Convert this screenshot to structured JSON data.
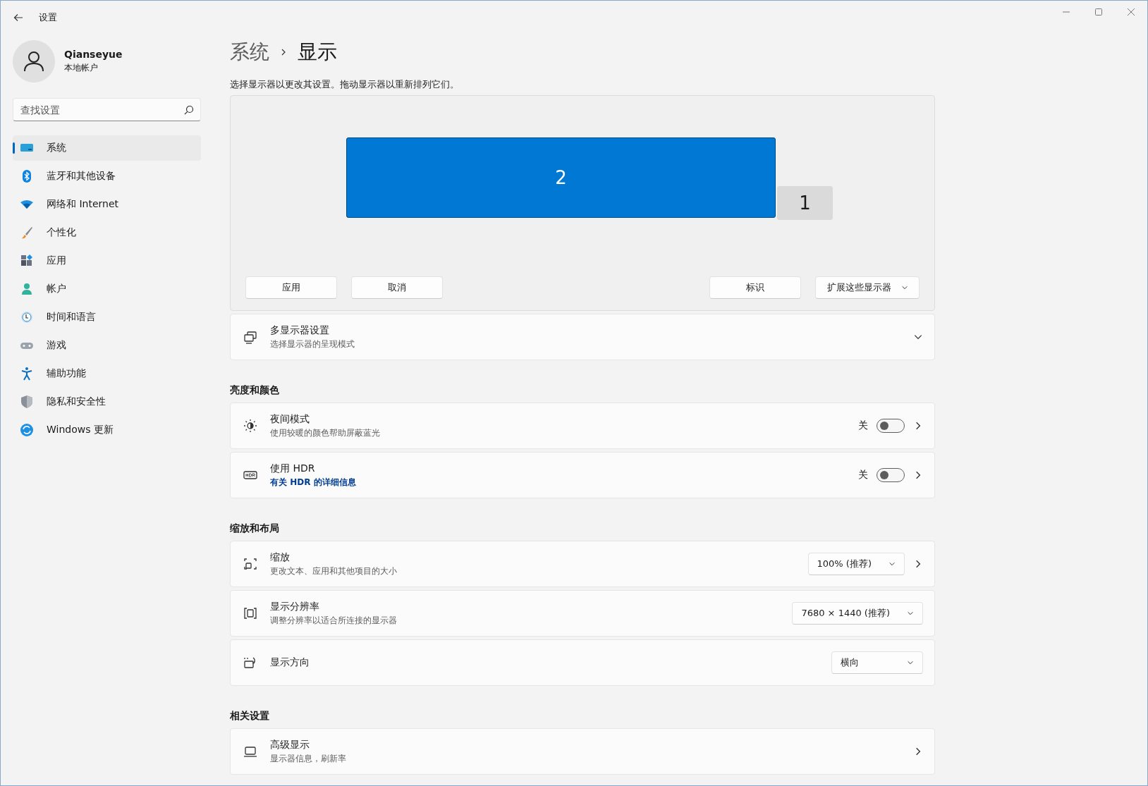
{
  "window": {
    "title": "设置"
  },
  "profile": {
    "name": "Qianseyue",
    "account": "本地帐户"
  },
  "search": {
    "placeholder": "查找设置"
  },
  "nav": [
    {
      "label": "系统",
      "selected": true
    },
    {
      "label": "蓝牙和其他设备",
      "selected": false
    },
    {
      "label": "网络和 Internet",
      "selected": false
    },
    {
      "label": "个性化",
      "selected": false
    },
    {
      "label": "应用",
      "selected": false
    },
    {
      "label": "帐户",
      "selected": false
    },
    {
      "label": "时间和语言",
      "selected": false
    },
    {
      "label": "游戏",
      "selected": false
    },
    {
      "label": "辅助功能",
      "selected": false
    },
    {
      "label": "隐私和安全性",
      "selected": false
    },
    {
      "label": "Windows 更新",
      "selected": false
    }
  ],
  "breadcrumb": [
    "系统",
    "显示"
  ],
  "arrangement": {
    "hint": "选择显示器以更改其设置。拖动显示器以重新排列它们。",
    "monitors": [
      {
        "label": "2",
        "selected": true
      },
      {
        "label": "1",
        "selected": false
      }
    ],
    "left_buttons": [
      "应用",
      "取消"
    ],
    "identify_button": "标识",
    "mode_dropdown": "扩展这些显示器"
  },
  "sections": [
    {
      "cards": [
        {
          "kind": "expander",
          "title": "多显示器设置",
          "subtitle": "选择显示器的呈现模式",
          "expanded": false
        }
      ]
    },
    {
      "heading": "亮度和颜色",
      "cards": [
        {
          "kind": "toggle",
          "title": "夜间模式",
          "subtitle": "使用较暖的颜色帮助屏蔽蓝光",
          "state_label": "关",
          "on": false
        },
        {
          "kind": "toggle",
          "title": "使用 HDR",
          "link": "有关 HDR 的详细信息",
          "state_label": "关",
          "on": false
        }
      ]
    },
    {
      "heading": "缩放和布局",
      "cards": [
        {
          "kind": "dropdown",
          "title": "缩放",
          "subtitle": "更改文本、应用和其他项目的大小",
          "value": "100% (推荐)",
          "chevron": true
        },
        {
          "kind": "dropdown",
          "title": "显示分辨率",
          "subtitle": "调整分辨率以适合所连接的显示器",
          "value": "7680 × 1440 (推荐)",
          "chevron": false
        },
        {
          "kind": "dropdown",
          "title": "显示方向",
          "value": "横向",
          "chevron": false
        }
      ]
    },
    {
      "heading": "相关设置",
      "cards": [
        {
          "kind": "link",
          "title": "高级显示",
          "subtitle": "显示器信息，刷新率"
        }
      ]
    }
  ]
}
